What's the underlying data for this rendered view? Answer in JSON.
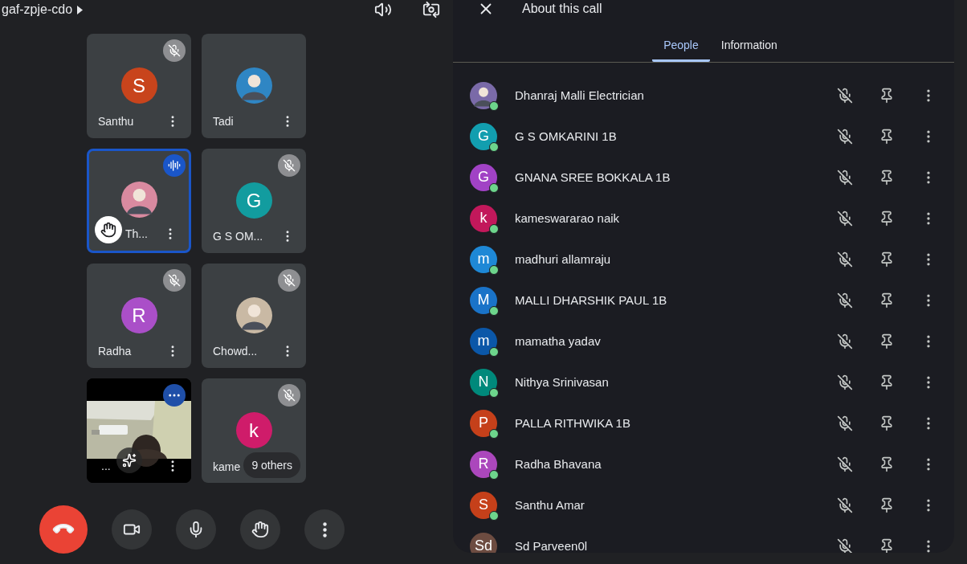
{
  "meeting": {
    "code": "gaf-zpje-cdo"
  },
  "tiles": [
    {
      "kind": "avatar",
      "name": "Santhu",
      "avatar": {
        "kind": "letter",
        "letter": "S",
        "color": "#c8441c"
      },
      "muted": true,
      "speaking": false,
      "hand_raised": false
    },
    {
      "kind": "avatar",
      "name": "Tadi",
      "muted": false,
      "speaking": false,
      "hand_raised": false
    },
    {
      "kind": "avatar",
      "name": "Th...",
      "muted": false,
      "speaking": true,
      "hand_raised": true
    },
    {
      "kind": "avatar",
      "name": "G S OM...",
      "avatar": {
        "kind": "letter",
        "letter": "G",
        "color": "#129c9f"
      },
      "muted": true,
      "speaking": false,
      "hand_raised": false
    },
    {
      "kind": "avatar",
      "name": "Radha",
      "avatar": {
        "kind": "letter",
        "letter": "R",
        "color": "#aa4fc8"
      },
      "muted": true,
      "speaking": false,
      "hand_raised": false
    },
    {
      "kind": "avatar",
      "name": "Chowd...",
      "muted": true,
      "speaking": false,
      "hand_raised": false
    },
    {
      "kind": "video",
      "name": "...",
      "muted": false,
      "speaking": false,
      "hand_raised": false
    },
    {
      "kind": "avatar",
      "name": "kame",
      "avatar": {
        "kind": "letter",
        "letter": "k",
        "color": "#cf1c6a"
      },
      "muted": true,
      "speaking": false,
      "hand_raised": false,
      "overflow": "9 others"
    }
  ],
  "panel": {
    "title": "About this call",
    "tabs": [
      {
        "label": "People",
        "selected": true
      },
      {
        "label": "Information",
        "selected": false
      }
    ],
    "people": [
      {
        "name": "Dhanraj Malli Electrician",
        "online": true
      },
      {
        "name": "G S OMKARINI 1B",
        "avatar": {
          "kind": "letter",
          "letter": "G",
          "color": "#129eaf"
        },
        "online": true
      },
      {
        "name": "GNANA SREE BOKKALA 1B",
        "avatar": {
          "kind": "letter",
          "letter": "G",
          "color": "#a142c5"
        },
        "online": true
      },
      {
        "name": "kameswararao naik",
        "avatar": {
          "kind": "letter",
          "letter": "k",
          "color": "#c2185b"
        },
        "online": true
      },
      {
        "name": "madhuri allamraju",
        "avatar": {
          "kind": "letter",
          "letter": "m",
          "color": "#1e88d6"
        },
        "online": true
      },
      {
        "name": "MALLI DHARSHIK PAUL 1B",
        "avatar": {
          "kind": "letter",
          "letter": "M",
          "color": "#1a73c8"
        },
        "online": true
      },
      {
        "name": "mamatha yadav",
        "avatar": {
          "kind": "letter",
          "letter": "m",
          "color": "#0b57a8"
        },
        "online": true
      },
      {
        "name": "Nithya Srinivasan",
        "avatar": {
          "kind": "letter",
          "letter": "N",
          "color": "#00897b"
        },
        "online": true
      },
      {
        "name": "PALLA RITHWIKA 1B",
        "avatar": {
          "kind": "letter",
          "letter": "P",
          "color": "#c5401a"
        },
        "online": true
      },
      {
        "name": "Radha Bhavana",
        "avatar": {
          "kind": "letter",
          "letter": "R",
          "color": "#ab47bc"
        },
        "online": true
      },
      {
        "name": "Santhu Amar",
        "avatar": {
          "kind": "letter",
          "letter": "S",
          "color": "#c5401a"
        },
        "online": true
      },
      {
        "name": "Sd Parveen0l",
        "avatar": {
          "kind": "letter",
          "letter": "Sd",
          "color": "#6d4c41"
        }
      }
    ]
  }
}
